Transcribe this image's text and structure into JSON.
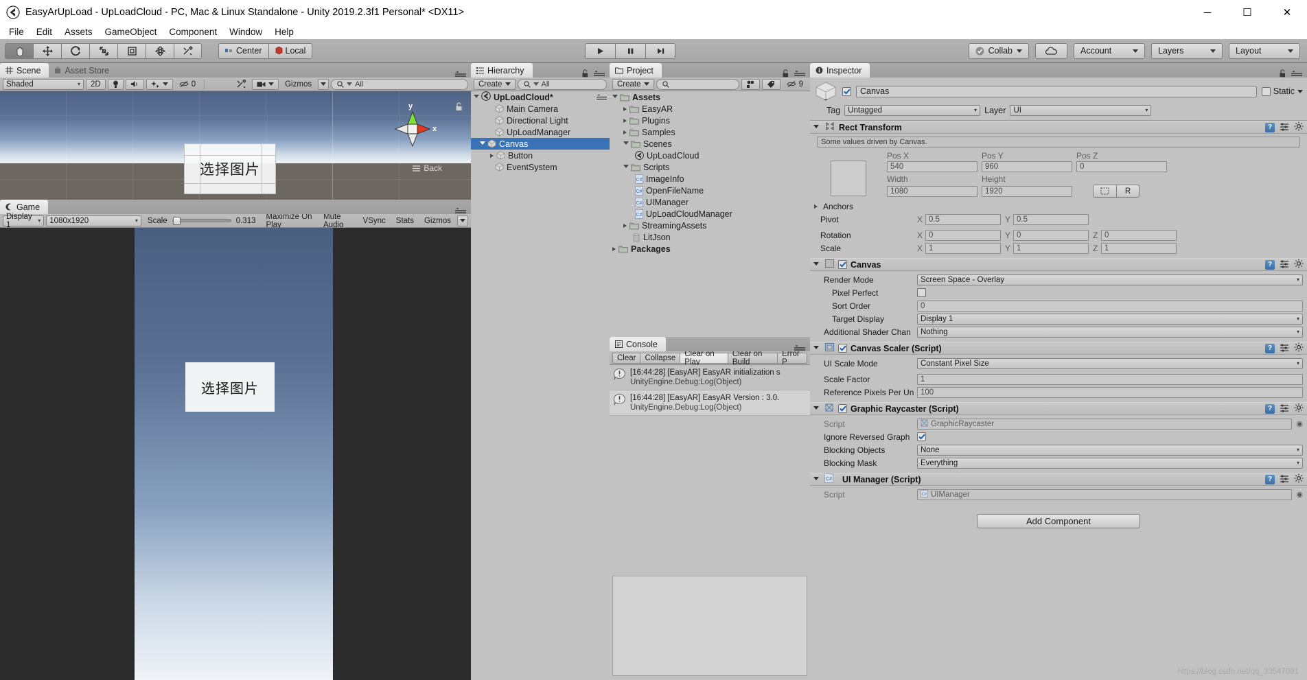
{
  "window": {
    "title": "EasyArUpLoad - UpLoadCloud - PC, Mac & Linux Standalone - Unity 2019.2.3f1 Personal* <DX11>",
    "minimize": "─",
    "maximize": "☐",
    "close": "✕"
  },
  "menubar": {
    "items": [
      "File",
      "Edit",
      "Assets",
      "GameObject",
      "Component",
      "Window",
      "Help"
    ]
  },
  "toolbar": {
    "transform_tools": [
      "hand-tool",
      "move-tool",
      "rotate-tool",
      "scale-tool",
      "rect-tool",
      "transform-tool",
      "custom-tool"
    ],
    "pivot_mode": "Center",
    "pivot_rotation": "Local",
    "play": "▶",
    "pause": "❚❚",
    "step": "▶|",
    "collab": "Collab",
    "cloud": "cloud-icon",
    "account": "Account",
    "layers": "Layers",
    "layout": "Layout"
  },
  "scene": {
    "tabs": [
      {
        "label": "Scene",
        "active": true
      },
      {
        "label": "Asset Store",
        "active": false
      }
    ],
    "shading": "Shaded",
    "mode_2d": "2D",
    "effects_count": "0",
    "gizmos": "Gizmos",
    "search_placeholder": "All",
    "gizmo_axis_x": "x",
    "gizmo_axis_y": "y",
    "view_label": "Back",
    "canvas_button_text": "选择图片"
  },
  "game": {
    "tab": "Game",
    "display": "Display 1",
    "resolution": "1080x1920",
    "scale_label": "Scale",
    "scale_value": "0.313",
    "maximize_on_play": "Maximize On Play",
    "mute_audio": "Mute Audio",
    "vsync": "VSync",
    "stats": "Stats",
    "gizmos": "Gizmos",
    "button_text": "选择图片"
  },
  "hierarchy": {
    "tab": "Hierarchy",
    "create": "Create",
    "search_placeholder": "All",
    "scene_name": "UpLoadCloud*",
    "items": [
      {
        "label": "Main Camera",
        "depth": 1,
        "expandable": false,
        "selected": false
      },
      {
        "label": "Directional Light",
        "depth": 1,
        "expandable": false,
        "selected": false
      },
      {
        "label": "UpLoadManager",
        "depth": 1,
        "expandable": false,
        "selected": false
      },
      {
        "label": "Canvas",
        "depth": 1,
        "expandable": true,
        "expanded": true,
        "selected": true
      },
      {
        "label": "Button",
        "depth": 2,
        "expandable": true,
        "expanded": false,
        "selected": false
      },
      {
        "label": "EventSystem",
        "depth": 1,
        "expandable": false,
        "selected": false
      }
    ]
  },
  "project": {
    "tab": "Project",
    "create": "Create",
    "search_placeholder": "",
    "hidden_count": "9",
    "items": [
      {
        "label": "Assets",
        "depth": 0,
        "type": "folder",
        "expandable": true,
        "expanded": true,
        "bold": true
      },
      {
        "label": "EasyAR",
        "depth": 1,
        "type": "folder",
        "expandable": true,
        "expanded": false
      },
      {
        "label": "Plugins",
        "depth": 1,
        "type": "folder",
        "expandable": true,
        "expanded": false
      },
      {
        "label": "Samples",
        "depth": 1,
        "type": "folder",
        "expandable": true,
        "expanded": false
      },
      {
        "label": "Scenes",
        "depth": 1,
        "type": "folder",
        "expandable": true,
        "expanded": true
      },
      {
        "label": "UpLoadCloud",
        "depth": 2,
        "type": "unity",
        "expandable": false
      },
      {
        "label": "Scripts",
        "depth": 1,
        "type": "folder",
        "expandable": true,
        "expanded": true
      },
      {
        "label": "ImageInfo",
        "depth": 2,
        "type": "cs",
        "expandable": false
      },
      {
        "label": "OpenFileName",
        "depth": 2,
        "type": "cs",
        "expandable": false
      },
      {
        "label": "UIManager",
        "depth": 2,
        "type": "cs",
        "expandable": false
      },
      {
        "label": "UpLoadCloudManager",
        "depth": 2,
        "type": "cs",
        "expandable": false
      },
      {
        "label": "StreamingAssets",
        "depth": 1,
        "type": "folder",
        "expandable": true,
        "expanded": false
      },
      {
        "label": "LitJson",
        "depth": 1,
        "type": "dll",
        "expandable": false
      },
      {
        "label": "Packages",
        "depth": 0,
        "type": "folder",
        "expandable": true,
        "expanded": false,
        "bold": true
      }
    ]
  },
  "console": {
    "tab": "Console",
    "buttons": [
      "Clear",
      "Collapse",
      "Clear on Play",
      "Clear on Build",
      "Error P"
    ],
    "active_button": "Clear on Play",
    "logs": [
      {
        "message": "[16:44:28] [EasyAR] EasyAR initialization s",
        "detail": "UnityEngine.Debug:Log(Object)"
      },
      {
        "message": "[16:44:28] [EasyAR] EasyAR Version : 3.0.",
        "detail": "UnityEngine.Debug:Log(Object)"
      }
    ]
  },
  "inspector": {
    "tab": "Inspector",
    "object_name": "Canvas",
    "enabled": true,
    "static_label": "Static",
    "tag_label": "Tag",
    "tag_value": "Untagged",
    "layer_label": "Layer",
    "layer_value": "UI",
    "rect_transform": {
      "title": "Rect Transform",
      "driven_note": "Some values driven by Canvas.",
      "col_pos_x": "Pos X",
      "col_pos_y": "Pos Y",
      "col_pos_z": "Pos Z",
      "pos_x": "540",
      "pos_y": "960",
      "pos_z": "0",
      "col_width": "Width",
      "col_height": "Height",
      "width": "1080",
      "height": "1920",
      "blueprint_btn": "blueprint-icon",
      "raw_btn": "R",
      "anchors_label": "Anchors",
      "pivot_label": "Pivot",
      "pivot_x": "0.5",
      "pivot_y": "0.5",
      "rotation_label": "Rotation",
      "rot_x": "0",
      "rot_y": "0",
      "rot_z": "0",
      "scale_label": "Scale",
      "scale_x": "1",
      "scale_y": "1",
      "scale_z": "1",
      "axis_x": "X",
      "axis_y": "Y",
      "axis_z": "Z"
    },
    "canvas": {
      "title": "Canvas",
      "enabled": true,
      "render_mode_label": "Render Mode",
      "render_mode_value": "Screen Space - Overlay",
      "pixel_perfect_label": "Pixel Perfect",
      "pixel_perfect_value": false,
      "sort_order_label": "Sort Order",
      "sort_order_value": "0",
      "target_display_label": "Target Display",
      "target_display_value": "Display 1",
      "shader_channels_label": "Additional Shader Chan",
      "shader_channels_value": "Nothing"
    },
    "canvas_scaler": {
      "title": "Canvas Scaler (Script)",
      "enabled": true,
      "ui_scale_mode_label": "UI Scale Mode",
      "ui_scale_mode_value": "Constant Pixel Size",
      "scale_factor_label": "Scale Factor",
      "scale_factor_value": "1",
      "ref_ppu_label": "Reference Pixels Per Un",
      "ref_ppu_value": "100"
    },
    "graphic_raycaster": {
      "title": "Graphic Raycaster (Script)",
      "enabled": true,
      "script_label": "Script",
      "script_value": "GraphicRaycaster",
      "ignore_reversed_label": "Ignore Reversed Graph",
      "ignore_reversed_value": true,
      "blocking_objects_label": "Blocking Objects",
      "blocking_objects_value": "None",
      "blocking_mask_label": "Blocking Mask",
      "blocking_mask_value": "Everything"
    },
    "ui_manager": {
      "title": "UI Manager (Script)",
      "script_label": "Script",
      "script_value": "UIManager"
    },
    "add_component": "Add Component"
  },
  "watermark": "https://blog.csdn.net/qq_33547091",
  "colors": {
    "selection_blue": "#3a72b8",
    "panel_bg": "#c2c2c2",
    "toolbar_bg": "#a8a8a8"
  }
}
